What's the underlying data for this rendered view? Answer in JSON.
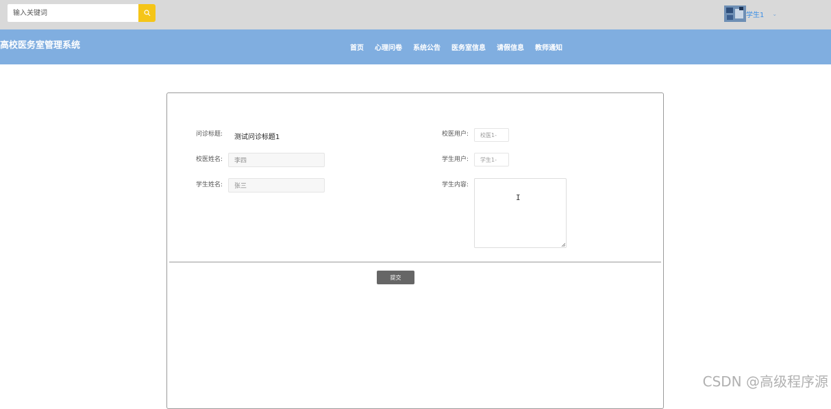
{
  "search": {
    "placeholder": "输入关键词",
    "icon": "search-icon"
  },
  "user": {
    "name": "学生1",
    "caret": "⌄"
  },
  "site": {
    "title": "高校医务室管理系统"
  },
  "nav": {
    "items": [
      "首页",
      "心理问卷",
      "系统公告",
      "医务室信息",
      "请假信息",
      "教师通知"
    ]
  },
  "form": {
    "title_label": "问诊标题:",
    "title_value": "测试问诊标题1",
    "doctor_name_label": "校医姓名:",
    "doctor_name_value": "李四",
    "student_name_label": "学生姓名:",
    "student_name_value": "张三",
    "doctor_user_label": "校医用户:",
    "doctor_user_value": "校医1-",
    "student_user_label": "学生用户:",
    "student_user_value": "学生1-",
    "student_content_label": "学生内容:",
    "submit_label": "提交"
  },
  "watermark": "CSDN @高级程序源",
  "colors": {
    "topbar": "#d9d9d9",
    "navbar": "#80aee0",
    "search_button": "#f5c518",
    "submit_button": "#666666"
  }
}
